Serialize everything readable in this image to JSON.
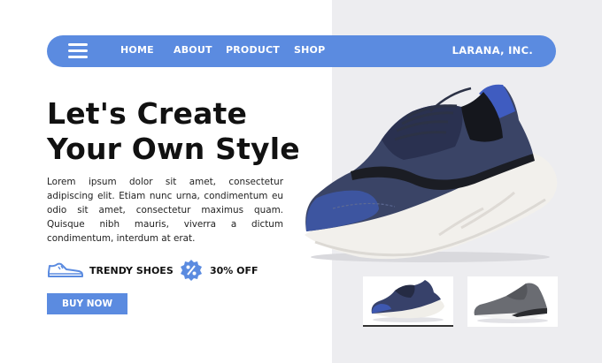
{
  "nav": {
    "menu_icon": "hamburger-menu-icon",
    "links": [
      "HOME",
      "ABOUT",
      "PRODUCT",
      "SHOP"
    ],
    "brand": "LARANA, INC."
  },
  "hero": {
    "headline_line1": "Let's Create",
    "headline_line2": "Your Own Style",
    "description": "Lorem ipsum dolor sit amet, consectetur adipiscing elit. Etiam nunc urna, condimentum eu odio sit amet, consectetur maximus quam. Quisque nibh mauris, viverra a dictum condimentum, interdum at erat."
  },
  "features": [
    {
      "icon": "shoe-icon",
      "label": "TRENDY SHOES"
    },
    {
      "icon": "percent-badge-icon",
      "label": "30% OFF"
    }
  ],
  "cta": {
    "label": "BUY NOW"
  },
  "product": {
    "main_image": "blue-black-sneaker",
    "thumbnails": [
      {
        "image": "blue-black-sneaker",
        "selected": true
      },
      {
        "image": "gray-sneaker",
        "selected": false
      }
    ]
  },
  "colors": {
    "accent": "#5b8be0",
    "right_panel": "#ededf0",
    "text": "#111111"
  }
}
